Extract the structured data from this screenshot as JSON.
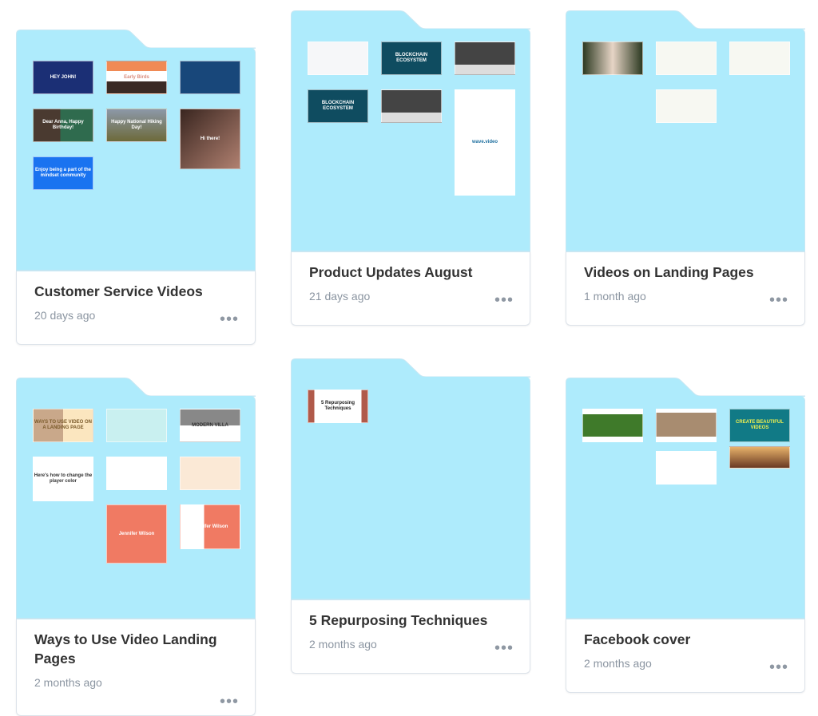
{
  "folder_color": "#aeebfc",
  "menu_icon": "more-horizontal-icon",
  "menu_label": "•••",
  "folders": [
    {
      "title": "Customer Service Videos",
      "date": "20 days ago",
      "thumbnails": [
        {
          "caption": "HEY JOHN!",
          "bg": "#1b2f75"
        },
        {
          "caption": "Early Birds",
          "bg": "linear-gradient(#f08a55 0 30%,#fff 30% 62%,#3a2a25 62%)",
          "color": "#d98a7a"
        },
        {
          "caption": "",
          "bg": "#18477a"
        },
        {
          "caption": "Dear Anna, Happy Birthday!",
          "bg": "linear-gradient(90deg,#4a3a30 45%,#2f6b4e 45%)"
        },
        {
          "caption": "Happy National Hiking Day!",
          "bg": "linear-gradient(#8c98a8,#6d6a3a)"
        },
        {
          "caption": "Hi there!",
          "bg": "linear-gradient(135deg,#3a2620,#b08070)"
        },
        {
          "caption": "Enjoy being a part of the mindset community",
          "bg": "#1a73f0"
        }
      ]
    },
    {
      "title": "Product Updates August",
      "date": "21 days ago",
      "thumbnails": [
        {
          "caption": "",
          "bg": "#f6f7f9"
        },
        {
          "caption": "BLOCKCHAIN ECOSYSTEM",
          "bg": "#0f4c60"
        },
        {
          "caption": "",
          "bg": "linear-gradient(#444 0 70%,#ddd 70%)"
        },
        {
          "caption": "BLOCKCHAIN ECOSYSTEM",
          "bg": "#0f4c60"
        },
        {
          "caption": "",
          "bg": "linear-gradient(#444 0 70%,#ddd 70%)"
        },
        {
          "caption": "wave.video",
          "bg": "#ffffff",
          "color": "#1e6f9f"
        }
      ]
    },
    {
      "title": "Videos on Landing Pages",
      "date": "1 month ago",
      "thumbnails": [
        {
          "caption": "",
          "bg": "linear-gradient(90deg,#2d3a22,#e7d5c6 50%,#2d3a22)"
        },
        {
          "caption": "",
          "bg": "#f7f8f2"
        },
        {
          "caption": "",
          "bg": "#f7f8f2"
        },
        {
          "caption": "",
          "bg": "#f7f8f2"
        }
      ]
    },
    {
      "title": "Ways to Use Video Landing Pages",
      "date": "2 months ago",
      "thumbnails": [
        {
          "caption": "WAYS TO USE VIDEO ON A LANDING PAGE",
          "bg": "linear-gradient(90deg,#c9a88a 50%,#fbe6bf 50%)",
          "color": "#7a5a2a"
        },
        {
          "caption": "",
          "bg": "#c9f0f0"
        },
        {
          "caption": "MODERN VILLA",
          "bg": "linear-gradient(#888 0 50%,#fff 50%)",
          "color": "#333"
        },
        {
          "caption": "Here's how to change the player color",
          "bg": "#ffffff",
          "color": "#333"
        },
        {
          "caption": "",
          "bg": "#ffffff"
        },
        {
          "caption": "",
          "bg": "#fbe9d6"
        },
        {
          "caption": "Jennifer Wilson",
          "bg": "#f07a63"
        },
        {
          "caption": "Jennifer Wilson",
          "bg": "linear-gradient(90deg,#fff 40%,#f07a63 40%)"
        }
      ]
    },
    {
      "title": "5 Repurposing Techniques",
      "date": "2 months ago",
      "thumbnails": [
        {
          "caption": "5 Repurposing Techniques",
          "bg": "linear-gradient(90deg,#b05a4a 10%,#fff 10% 90%,#b05a4a 90%)",
          "color": "#222"
        }
      ]
    },
    {
      "title": "Facebook cover",
      "date": "2 months ago",
      "thumbnails": [
        {
          "caption": "",
          "bg": "linear-gradient(#fff 0 15%,#3f7a2a 15% 85%,#fff 85%)"
        },
        {
          "caption": "",
          "bg": "linear-gradient(#fff 0 10%,#a88c70 10% 85%,#fff 85%)"
        },
        {
          "caption": "CREATE BEAUTIFUL VIDEOS",
          "bg": "#117a86",
          "color": "#f0f050"
        },
        {
          "caption": "",
          "bg": "#ffffff"
        },
        {
          "caption": "",
          "bg": "linear-gradient(#e7b26a,#6a3a22)"
        }
      ]
    }
  ]
}
